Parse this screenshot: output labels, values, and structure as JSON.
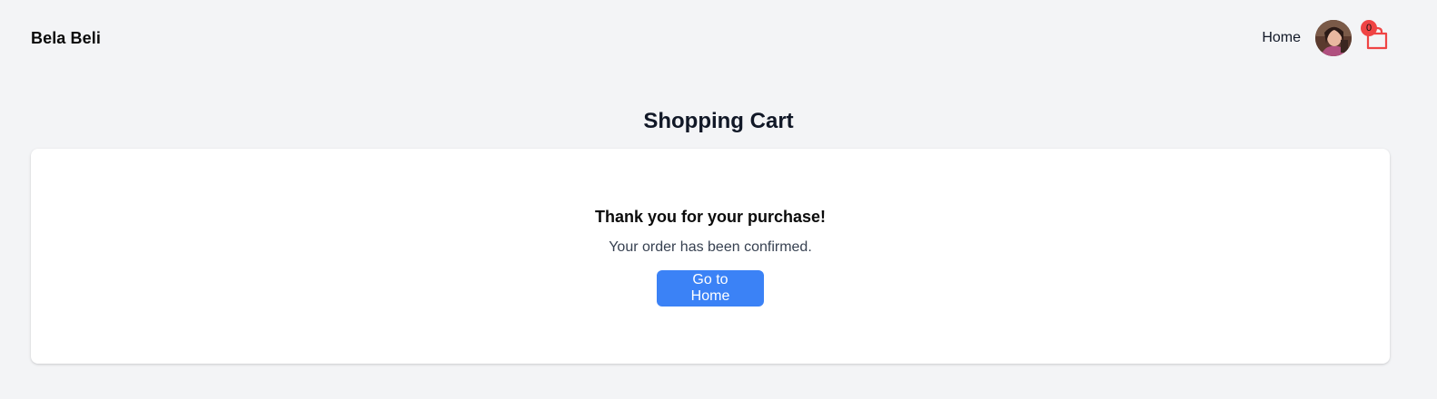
{
  "navbar": {
    "brand": "Bela Beli",
    "home_link": "Home",
    "cart_count": "0",
    "avatar_icon": "user-avatar",
    "cart_icon": "shopping-bag-icon",
    "cart_color": "#ef4444"
  },
  "page": {
    "title": "Shopping Cart"
  },
  "confirmation": {
    "heading": "Thank you for your purchase!",
    "message": "Your order has been confirmed.",
    "button_label": "Go to Home",
    "button_color": "#3b82f6"
  }
}
